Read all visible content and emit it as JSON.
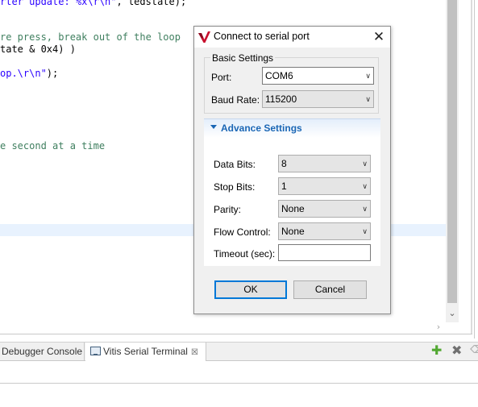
{
  "editor": {
    "lines": [
      {
        "segments": [
          {
            "text": "rter update: ",
            "color": "blue"
          },
          {
            "text": "%x\\r\\n\"",
            "color": "blue"
          },
          {
            "text": ", ledstate);",
            "color": "black"
          }
        ]
      },
      {
        "segments": [
          {
            "text": "re press, break out of the loop",
            "color": "green"
          }
        ]
      },
      {
        "segments": [
          {
            "text": "tate & 0x4) )",
            "color": "black"
          }
        ]
      },
      {
        "segments": [
          {
            "text": "op.\\r\\n\"",
            "color": "blue"
          },
          {
            "text": ");",
            "color": "black"
          }
        ]
      },
      {
        "segments": [
          {
            "text": "e second at a time",
            "color": "green"
          }
        ]
      }
    ]
  },
  "bottom_tabs": {
    "debugger_label": "Debugger Console",
    "serial_label": "Vitis Serial Terminal",
    "close_glyph": "☒"
  },
  "dialog": {
    "title": "Connect to serial port",
    "basic_settings": {
      "title": "Basic Settings",
      "port_label": "Port:",
      "port_value": "COM6",
      "baud_label": "Baud Rate:",
      "baud_value": "115200"
    },
    "advance_settings": {
      "title": "Advance Settings",
      "data_bits_label": "Data Bits:",
      "data_bits_value": "8",
      "stop_bits_label": "Stop Bits:",
      "stop_bits_value": "1",
      "parity_label": "Parity:",
      "parity_value": "None",
      "flow_control_label": "Flow Control:",
      "flow_control_value": "None",
      "timeout_label": "Timeout (sec):",
      "timeout_value": ""
    },
    "ok_label": "OK",
    "cancel_label": "Cancel"
  },
  "colors": {
    "accent": "#0078d7",
    "advance_title": "#1a66b5",
    "code_comment": "#3f7f5f",
    "code_string": "#2a00ff"
  },
  "icons": {
    "app": "vitis-logo-icon",
    "close": "close-icon",
    "dropdown": "chevron-down-icon",
    "expand": "triangle-down-icon",
    "terminal": "terminal-icon",
    "add": "plus-icon",
    "remove": "x-icon"
  }
}
